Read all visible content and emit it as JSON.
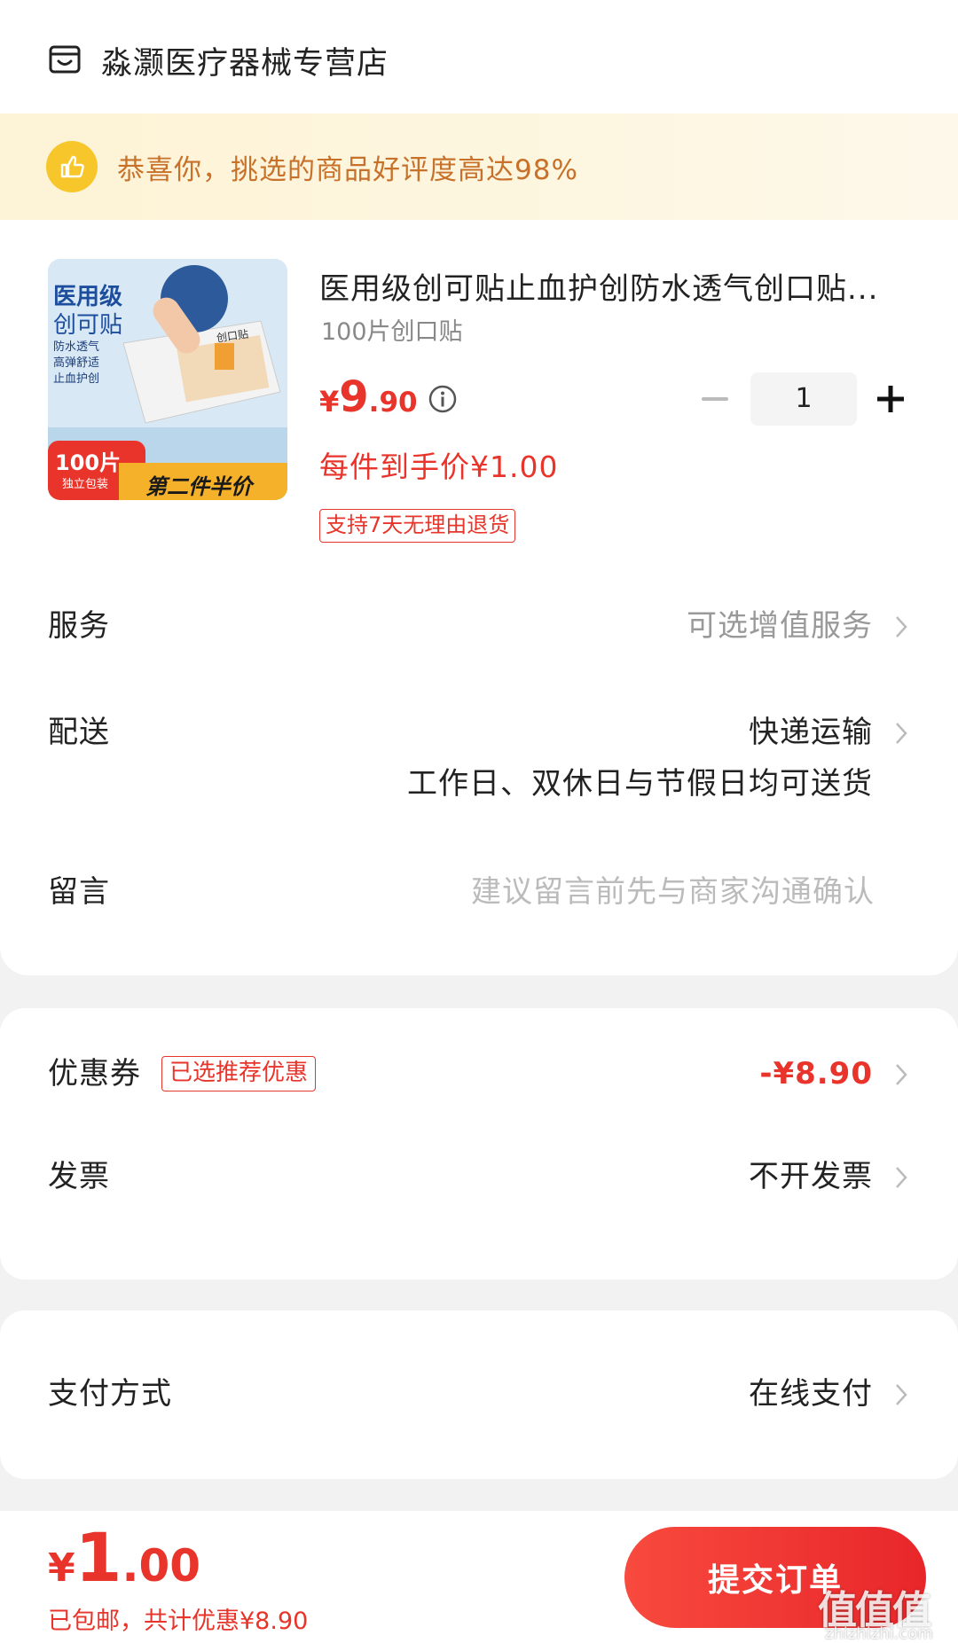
{
  "store": {
    "name": "淼灏医疗器械专营店",
    "icon": "store-icon"
  },
  "banner": {
    "text": "恭喜你，挑选的商品好评度高达98%",
    "icon": "thumbs-up-icon"
  },
  "product": {
    "title": "医用级创可贴止血护创防水透气创口贴...",
    "spec": "100片创口贴",
    "price_symbol": "¥",
    "price_int": "9",
    "price_dec": ".90",
    "per_item_price": "每件到手价¥1.00",
    "return_tag": "支持7天无理由退货",
    "quantity": "1",
    "image": {
      "line1": "医用级",
      "line2": "创可贴",
      "features": [
        "防水透气",
        "高弹舒适",
        "止血护创"
      ],
      "box_label": "创口贴",
      "count_badge": "100片",
      "count_sub": "独立包装",
      "promo": "第二件半价"
    }
  },
  "rows": {
    "service": {
      "label": "服务",
      "value": "可选增值服务"
    },
    "delivery": {
      "label": "配送",
      "value": "快递运输",
      "sub": "工作日、双休日与节假日均可送货"
    },
    "message": {
      "label": "留言",
      "placeholder": "建议留言前先与商家沟通确认"
    },
    "coupon": {
      "label": "优惠券",
      "tag": "已选推荐优惠",
      "value": "-¥8.90"
    },
    "invoice": {
      "label": "发票",
      "value": "不开发票"
    },
    "payment": {
      "label": "支付方式",
      "value": "在线支付"
    }
  },
  "bottom": {
    "total_symbol": "¥",
    "total_int": "1",
    "total_dec": ".00",
    "note": "已包邮，共计优惠¥8.90",
    "submit_label": "提交订单"
  },
  "watermark": {
    "text": "值值值",
    "url": "zhizhizhi.com"
  },
  "colors": {
    "accent": "#e8342a",
    "banner_text": "#c8712a",
    "banner_bg": "#fdf3d6"
  }
}
